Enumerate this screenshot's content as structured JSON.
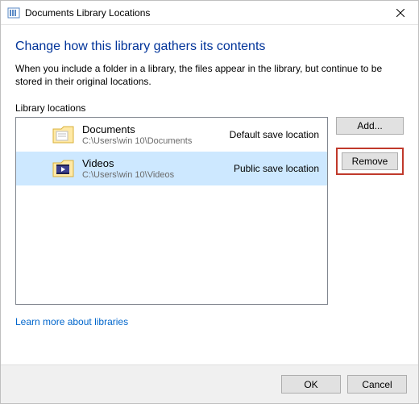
{
  "window": {
    "title": "Documents Library Locations"
  },
  "heading": "Change how this library gathers its contents",
  "description": "When you include a folder in a library, the files appear in the library, but continue to be stored in their original locations.",
  "section_label": "Library locations",
  "locations": [
    {
      "name": "Documents",
      "path": "C:\\Users\\win 10\\Documents",
      "tag": "Default save location",
      "selected": false,
      "icon": "folder-doc"
    },
    {
      "name": "Videos",
      "path": "C:\\Users\\win 10\\Videos",
      "tag": "Public save location",
      "selected": true,
      "icon": "folder-video"
    }
  ],
  "buttons": {
    "add": "Add...",
    "remove": "Remove",
    "ok": "OK",
    "cancel": "Cancel"
  },
  "link": "Learn more about libraries"
}
